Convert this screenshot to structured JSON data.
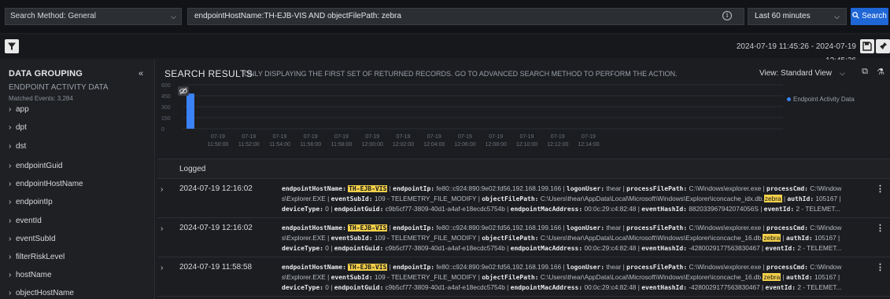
{
  "toolbar": {
    "search_method": "Search Method: General",
    "query": "endpointHostName:TH-EJB-VIS AND objectFilePath: zebra",
    "time_range": "Last 60 minutes",
    "search_label": "Search",
    "date_range": "2024-07-19 11:45:26 - 2024-07-19 12:45:26"
  },
  "sidebar": {
    "title": "DATA GROUPING",
    "subtitle": "ENDPOINT ACTIVITY DATA",
    "matched": "Matched Events: 3,284",
    "items": [
      "app",
      "dpt",
      "dst",
      "endpointGuid",
      "endpointHostName",
      "endpointIp",
      "eventId",
      "eventSubId",
      "filterRiskLevel",
      "hostName",
      "objectHostName"
    ]
  },
  "results": {
    "title": "SEARCH RESULTS",
    "note": "ONLY DISPLAYING THE FIRST SET OF RETURNED RECORDS. GO TO ADVANCED SEARCH METHOD TO PERFORM THE ACTION.",
    "view": "View: Standard View",
    "column_header": "Logged"
  },
  "chart_data": {
    "type": "bar",
    "y_ticks": [
      "600",
      "450",
      "300",
      "150",
      "0"
    ],
    "ylim": [
      0,
      600
    ],
    "x_ticks": [
      [
        "07-19",
        "11:50:00"
      ],
      [
        "07-19",
        "11:52:00"
      ],
      [
        "07-19",
        "11:54:00"
      ],
      [
        "07-19",
        "11:56:00"
      ],
      [
        "07-19",
        "11:58:00"
      ],
      [
        "07-19",
        "12:00:00"
      ],
      [
        "07-19",
        "12:02:00"
      ],
      [
        "07-19",
        "12:04:00"
      ],
      [
        "07-19",
        "12:06:00"
      ],
      [
        "07-19",
        "12:08:00"
      ],
      [
        "07-19",
        "12:10:00"
      ],
      [
        "07-19",
        "12:12:00"
      ],
      [
        "07-19",
        "12:14:00"
      ]
    ],
    "series": [
      {
        "name": "Endpoint Activity Data",
        "values": [
          {
            "x": "11:48:00",
            "y": 480
          }
        ]
      }
    ],
    "legend_position": "top-right",
    "bar_color": "#3a82f6"
  },
  "rows": [
    {
      "time": "2024-07-19 12:16:02",
      "host": "TH-EJB-VIS",
      "ip": "fe80::c924:890:9e02:fd56,192.168.199.166",
      "logonUser": "thear",
      "processFilePath": "C:\\Windows\\explorer.exe",
      "processCmd_a": "C:\\Window",
      "processCmd_b": "s\\Explorer.EXE",
      "eventSubId": "109 - TELEMETRY_FILE_MODIFY",
      "objectFilePath_pre": "C:\\Users\\thear\\AppData\\Local\\Microsoft\\Windows\\Explorer\\iconcache_idx.db.",
      "match": "zebra",
      "authId": "105167",
      "deviceType": "0",
      "endpointGuid": "c9b5cf77-3809-40d1-a4af-e18ecdc5754b",
      "endpointMacAddress": "00:0c:29:c4:82:48",
      "eventHashId": "882033967942074056S",
      "eventId": "2 - TELEMET..."
    },
    {
      "time": "2024-07-19 12:16:02",
      "host": "TH-EJB-VIS",
      "ip": "fe80::c924:890:9e02:fd56,192.168.199.166",
      "logonUser": "thear",
      "processFilePath": "C:\\Windows\\explorer.exe",
      "processCmd_a": "C:\\Window",
      "processCmd_b": "s\\Explorer.EXE",
      "eventSubId": "109 - TELEMETRY_FILE_MODIFY",
      "objectFilePath_pre": "C:\\Users\\thear\\AppData\\Local\\Microsoft\\Windows\\Explorer\\iconcache_16.db.",
      "match": "zebra",
      "authId": "105167",
      "deviceType": "0",
      "endpointGuid": "c9b5cf77-3809-40d1-a4af-e18ecdc5754b",
      "endpointMacAddress": "00:0c:29:c4:82:48",
      "eventHashId": "-4280029177563830467",
      "eventId": "2 - TELEMET..."
    },
    {
      "time": "2024-07-19 11:58:58",
      "host": "TH-EJB-VIS",
      "ip": "fe80::c924:890:9e02:fd56,192.168.199.166",
      "logonUser": "thear",
      "processFilePath": "C:\\Windows\\explorer.exe",
      "processCmd_a": "C:\\Window",
      "processCmd_b": "s\\Explorer.EXE",
      "eventSubId": "109 - TELEMETRY_FILE_MODIFY",
      "objectFilePath_pre": "C:\\Users\\thear\\AppData\\Local\\Microsoft\\Windows\\Explorer\\iconcache_16.db.",
      "match": "zebra",
      "authId": "105167",
      "deviceType": "0",
      "endpointGuid": "c9b5cf77-3809-40d1-a4af-e18ecdc5754b",
      "endpointMacAddress": "00:0c:29:c4:82:48",
      "eventHashId": "-4280029177563830467",
      "eventId": "2 - TELEMET..."
    }
  ],
  "labels": {
    "endpointHostName": "endpointHostName:",
    "endpointIp": "endpointIp:",
    "logonUser": "logonUser:",
    "processFilePath": "processFilePath:",
    "processCmd": "processCmd:",
    "eventSubId": "eventSubId:",
    "objectFilePath": "objectFilePath:",
    "authId": "authId:",
    "deviceType": "deviceType:",
    "endpointGuid": "endpointGuid:",
    "endpointMacAddress": "endpointMacAddress:",
    "eventHashId": "eventHashId:",
    "eventId": "eventId:"
  }
}
